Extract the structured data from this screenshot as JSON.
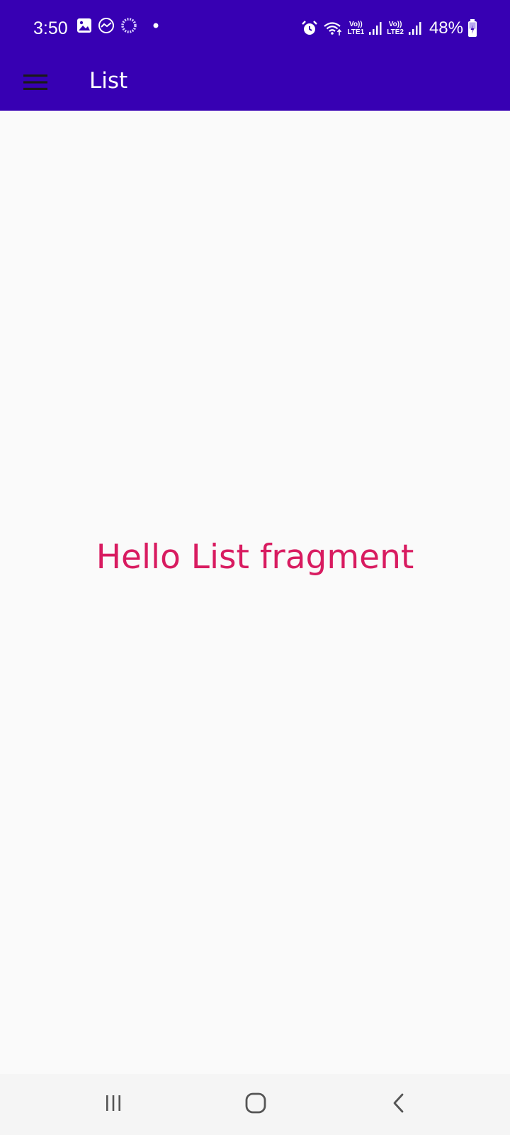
{
  "status_bar": {
    "time": "3:50",
    "left_icons": [
      "image-icon",
      "analytics-icon",
      "loading-ring-icon",
      "dot-icon"
    ],
    "lte1_top": "Vo))",
    "lte1_bottom": "LTE1",
    "lte2_top": "Vo))",
    "lte2_bottom": "LTE2",
    "battery": "48%",
    "colors": {
      "background": "#3700B3",
      "foreground": "#FFFFFF"
    }
  },
  "app_bar": {
    "title": "List",
    "menu_icon": "hamburger-menu-icon",
    "colors": {
      "background": "#3700B3",
      "title": "#FFFFFF",
      "menu_icon": "#1A1A1A"
    }
  },
  "content": {
    "message": "Hello List fragment",
    "colors": {
      "message": "#D81B60",
      "background": "#FAFAFA"
    }
  },
  "nav_bar": {
    "buttons": [
      "recent-apps-icon",
      "home-icon",
      "back-icon"
    ]
  }
}
